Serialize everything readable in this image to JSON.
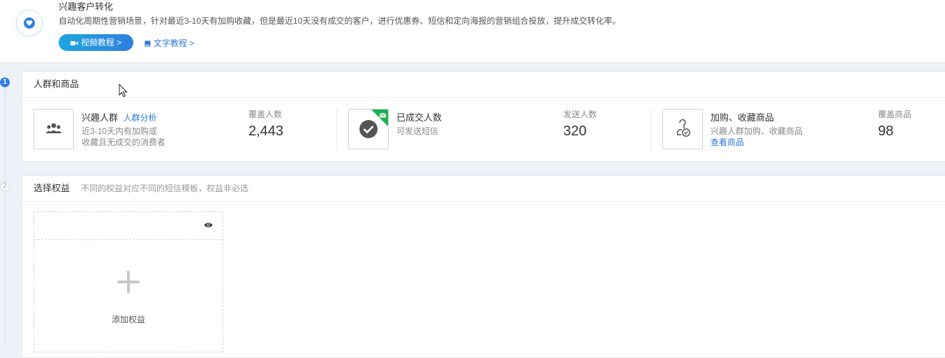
{
  "header": {
    "title": "兴趣客户转化",
    "description": "自动化周期性营销场景，针对最近3-10天有加购收藏，但是最近10天没有成交的客户，进行优惠券、短信和定向海报的营销组合投放，提升成交转化率。",
    "video_button": "视频教程 >",
    "doc_link": "文字教程 >",
    "icon": "heart-icon"
  },
  "steps": [
    "1",
    "2"
  ],
  "section1": {
    "title": "人群和商品",
    "cards": [
      {
        "icon": "group-icon",
        "title": "兴趣人群",
        "link": "人群分析",
        "desc_line1": "近3-10天内有加购或",
        "desc_line2": "收藏且无成交的消费者",
        "metric_label": "覆盖人数",
        "metric_value": "2,443"
      },
      {
        "icon": "check-circle-icon",
        "title": "已成交人数",
        "desc_line1": "可发送短信",
        "metric_label": "发送人数",
        "metric_value": "320"
      },
      {
        "icon": "cart-favorite-icon",
        "title": "加购、收藏商品",
        "desc_line1": "兴趣人群加购、收藏商品",
        "link": "查看商品",
        "metric_label": "覆盖商品",
        "metric_value": "98"
      }
    ]
  },
  "section2": {
    "title": "选择权益",
    "subtitle": "不同的权益对应不同的短信模板，权益非必选",
    "add_label": "添加权益"
  },
  "colors": {
    "accent": "#2f7fe0",
    "link": "#2a7bd8",
    "badge_green": "#18b24b",
    "background": "#eef2f8"
  }
}
